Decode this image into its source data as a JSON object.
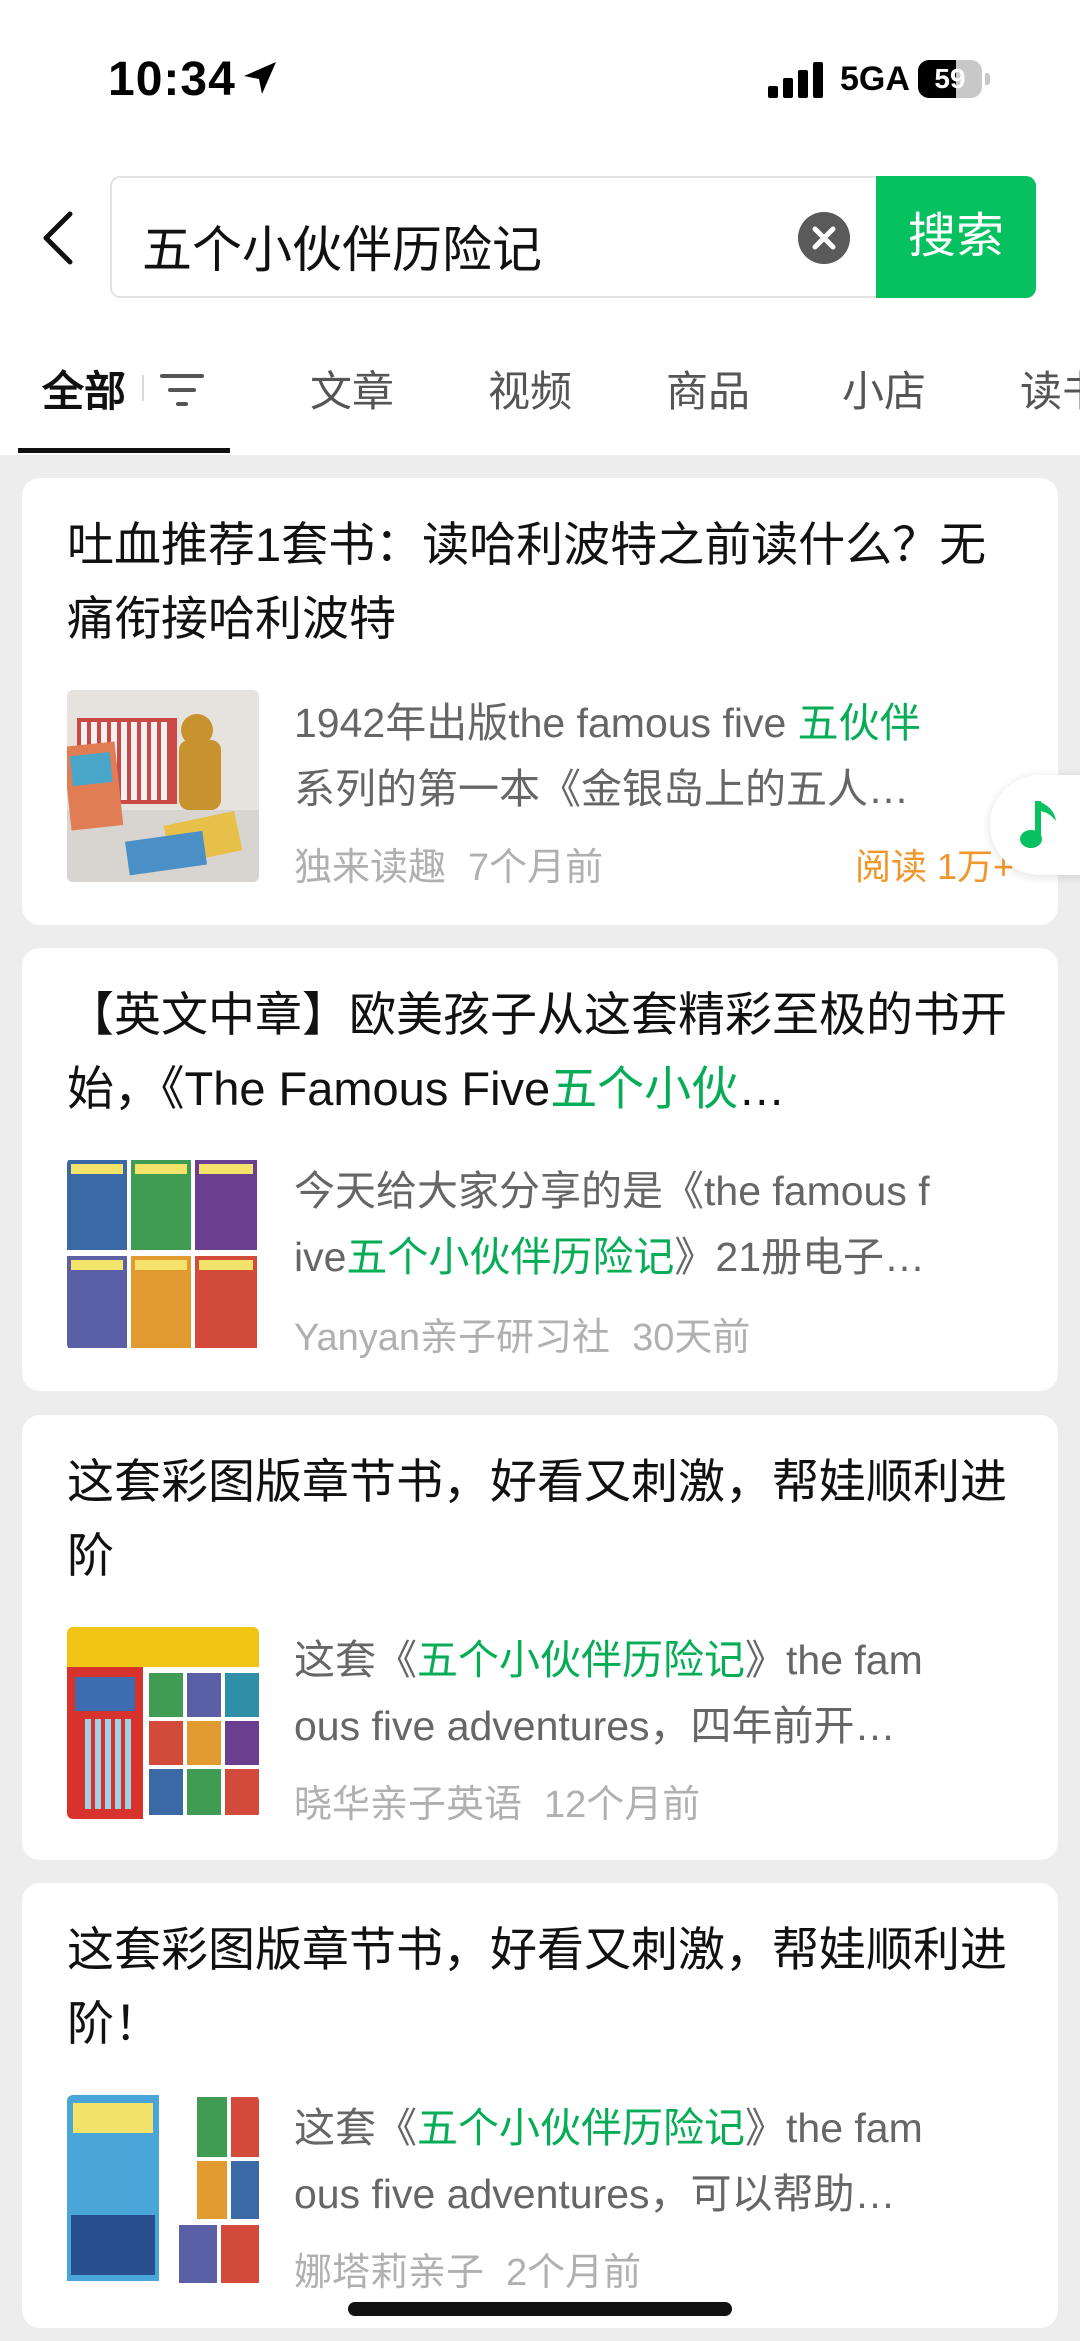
{
  "status_bar": {
    "time": "10:34",
    "network": "5GA",
    "battery": "59",
    "battery_level": 0.59
  },
  "search": {
    "query": "五个小伙伴历险记",
    "button_label": "搜索"
  },
  "tabs": [
    "全部",
    "文章",
    "视频",
    "商品",
    "小店",
    "读书"
  ],
  "results": [
    {
      "title_parts": [
        "吐血推荐1套书：读哈利波特之前读什么？无痛衔接哈利波特",
        "",
        ""
      ],
      "snippet_line1": [
        "1942年出版the famous five ",
        "五伙伴",
        ""
      ],
      "snippet_line2": [
        "系列的第一本《金银岛上的五人…",
        "",
        ""
      ],
      "source": "独来读趣",
      "time": "7个月前",
      "reads": "阅读 1万+"
    },
    {
      "title_parts": [
        "【英文中章】欧美孩子从这套精彩至极的书开始，《The Famous Five",
        "五个小伙",
        "…"
      ],
      "snippet_line1": [
        "今天给大家分享的是《the famous f",
        "",
        ""
      ],
      "snippet_line2": [
        "ive",
        "五个小伙伴历险记",
        "》21册电子…"
      ],
      "source": "Yanyan亲子研习社",
      "time": "30天前",
      "reads": ""
    },
    {
      "title_parts": [
        "这套彩图版章节书，好看又刺激，帮娃顺利进阶",
        "",
        ""
      ],
      "snippet_line1": [
        "这套《",
        "五个小伙伴历险记",
        "》the fam"
      ],
      "snippet_line2": [
        "ous five adventures，四年前开…",
        "",
        ""
      ],
      "source": "晓华亲子英语",
      "time": "12个月前",
      "reads": ""
    },
    {
      "title_parts": [
        "这套彩图版章节书，好看又刺激，帮娃顺利进阶！",
        "",
        ""
      ],
      "snippet_line1": [
        "这套《",
        "五个小伙伴历险记",
        "》the fam"
      ],
      "snippet_line2": [
        "ous five adventures，可以帮助…",
        "",
        ""
      ],
      "source": "娜塔莉亲子",
      "time": "2个月前",
      "reads": ""
    }
  ],
  "colors": {
    "accent": "#07c160",
    "highlight": "#07ad56",
    "reads": "#f0962a"
  }
}
